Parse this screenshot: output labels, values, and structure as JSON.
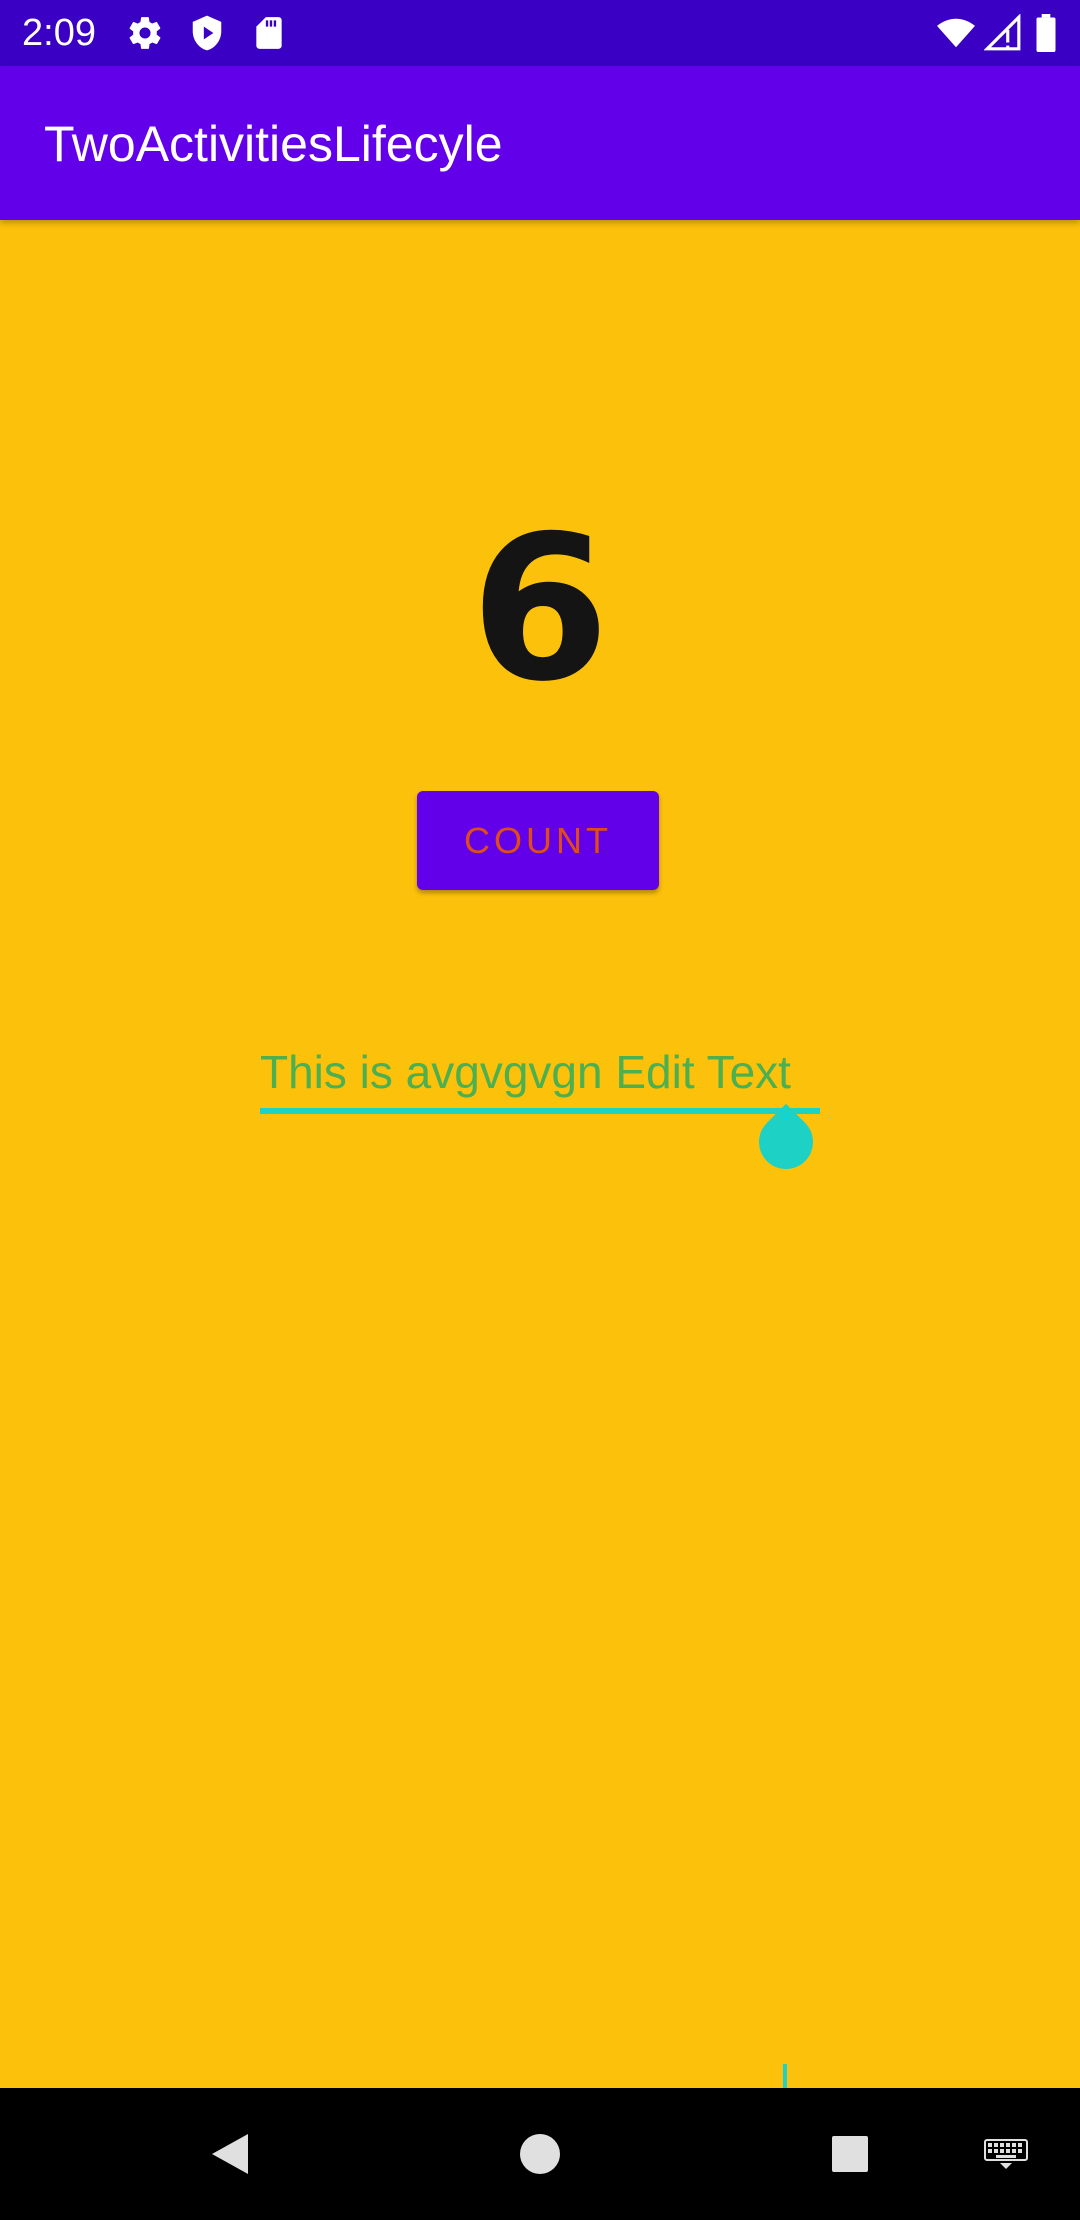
{
  "status_bar": {
    "time": "2:09",
    "left_icons": [
      "gear-icon",
      "shield-play-icon",
      "sd-card-icon"
    ],
    "right_icons": [
      "wifi-icon",
      "signal-icon",
      "battery-icon"
    ]
  },
  "app_bar": {
    "title": "TwoActivitiesLifecyle"
  },
  "main": {
    "count_value": "6",
    "count_button_label": "COUNT",
    "edit_text_value": "This is avgvgvgn Edit Text"
  },
  "nav_bar": {
    "buttons": [
      "back-icon",
      "home-icon",
      "recents-icon",
      "keyboard-icon"
    ]
  },
  "colors": {
    "background": "#FCC10B",
    "app_bar": "#6200EA",
    "status_bar": "#3A00C4",
    "button_text": "#E04B1A",
    "edit_text": "#4CAF50",
    "accent": "#1DD1C4"
  }
}
